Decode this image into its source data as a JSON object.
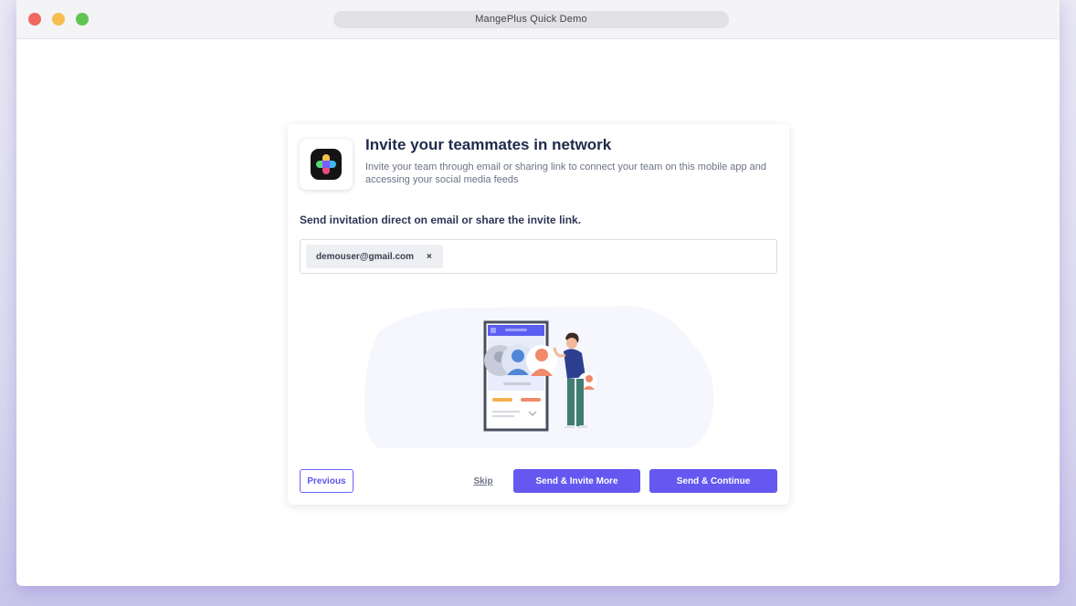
{
  "window": {
    "title": "MangePlus Quick Demo"
  },
  "invite": {
    "heading": "Invite your teammates in network",
    "description": "Invite your team through email or sharing link to connect your team on this mobile app and accessing your social media feeds",
    "section_label": "Send invitation direct on email or share the invite link.",
    "emails": [
      "demouser@gmail.com"
    ],
    "chip_remove": "×"
  },
  "actions": {
    "previous": "Previous",
    "skip": "Skip",
    "send_invite_more": "Send & Invite More",
    "send_continue": "Send & Continue"
  },
  "icons": {
    "logo": "app-logo-icon",
    "illustration": "team-invite-illustration"
  },
  "colors": {
    "accent": "#6458f0",
    "heading": "#1f2a4a",
    "muted": "#6b7385"
  }
}
